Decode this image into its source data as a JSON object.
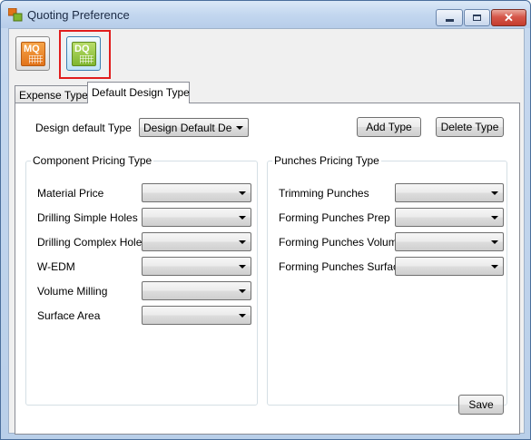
{
  "window": {
    "title": "Quoting Preference",
    "close_glyph": "✕"
  },
  "toolbar": {
    "mq": {
      "label": "MQ",
      "icon": "mq-icon"
    },
    "dq": {
      "label": "DQ",
      "icon": "dq-icon",
      "selected": true
    }
  },
  "tabs": [
    {
      "label": "Expense Types",
      "active": false
    },
    {
      "label": "Default Design Type",
      "active": true
    }
  ],
  "design": {
    "label": "Design default Type",
    "value": "Design Default Demo",
    "add_label": "Add Type",
    "delete_label": "Delete Type"
  },
  "component_group": {
    "title": "Component Pricing Type",
    "rows": [
      {
        "label": "Material Price",
        "value": ""
      },
      {
        "label": "Drilling Simple Holes",
        "value": ""
      },
      {
        "label": "Drilling Complex Holes",
        "value": ""
      },
      {
        "label": "W-EDM",
        "value": ""
      },
      {
        "label": "Volume Milling",
        "value": ""
      },
      {
        "label": "Surface Area",
        "value": ""
      }
    ]
  },
  "punches_group": {
    "title": "Punches Pricing Type",
    "rows": [
      {
        "label": "Trimming Punches",
        "value": ""
      },
      {
        "label": "Forming Punches Prep",
        "value": ""
      },
      {
        "label": "Forming Punches Volume",
        "value": ""
      },
      {
        "label": "Forming Punches Surface",
        "value": ""
      }
    ]
  },
  "footer": {
    "save_label": "Save"
  },
  "colors": {
    "highlight": "#e11d1d",
    "accent_mq": "#e2731a",
    "accent_dq": "#7fb62f"
  }
}
